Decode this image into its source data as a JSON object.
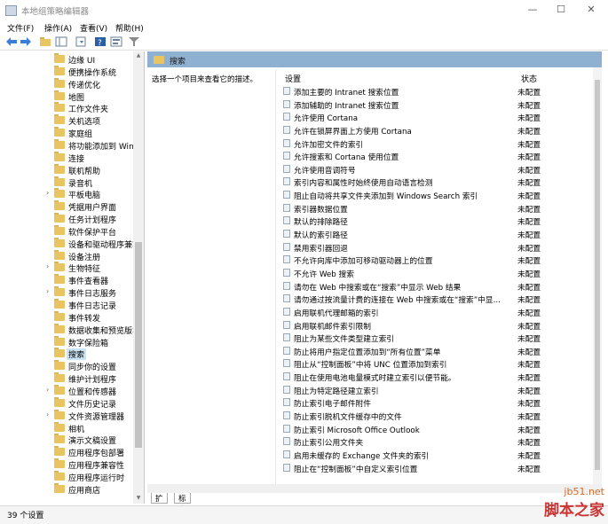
{
  "window": {
    "title": "本地组策略编辑器",
    "controls": {
      "minimize": "—",
      "maximize": "☐",
      "close": "✕"
    }
  },
  "menu": [
    "文件(F)",
    "操作(A)",
    "查看(V)",
    "帮助(H)"
  ],
  "tree": {
    "items": [
      {
        "label": "边缘 UI",
        "expander": ""
      },
      {
        "label": "便携操作系统",
        "expander": ""
      },
      {
        "label": "传递优化",
        "expander": ""
      },
      {
        "label": "地图",
        "expander": ""
      },
      {
        "label": "工作文件夹",
        "expander": ""
      },
      {
        "label": "关机选项",
        "expander": ""
      },
      {
        "label": "家庭组",
        "expander": ""
      },
      {
        "label": "将功能添加到 Wind",
        "expander": ""
      },
      {
        "label": "连接",
        "expander": ""
      },
      {
        "label": "联机帮助",
        "expander": ""
      },
      {
        "label": "录音机",
        "expander": ""
      },
      {
        "label": "平板电脑",
        "expander": "›"
      },
      {
        "label": "凭据用户界面",
        "expander": ""
      },
      {
        "label": "任务计划程序",
        "expander": ""
      },
      {
        "label": "软件保护平台",
        "expander": ""
      },
      {
        "label": "设备和驱动程序兼容",
        "expander": ""
      },
      {
        "label": "设备注册",
        "expander": ""
      },
      {
        "label": "生物特征",
        "expander": "›"
      },
      {
        "label": "事件查看器",
        "expander": ""
      },
      {
        "label": "事件日志服务",
        "expander": "›"
      },
      {
        "label": "事件日志记录",
        "expander": ""
      },
      {
        "label": "事件转发",
        "expander": ""
      },
      {
        "label": "数据收集和预览版本",
        "expander": ""
      },
      {
        "label": "数字保险箱",
        "expander": ""
      },
      {
        "label": "搜索",
        "expander": "",
        "selected": true
      },
      {
        "label": "同步你的设置",
        "expander": ""
      },
      {
        "label": "维护计划程序",
        "expander": ""
      },
      {
        "label": "位置和传感器",
        "expander": "›"
      },
      {
        "label": "文件历史记录",
        "expander": ""
      },
      {
        "label": "文件资源管理器",
        "expander": "›"
      },
      {
        "label": "相机",
        "expander": ""
      },
      {
        "label": "演示文稿设置",
        "expander": ""
      },
      {
        "label": "应用程序包部署",
        "expander": ""
      },
      {
        "label": "应用程序兼容性",
        "expander": ""
      },
      {
        "label": "应用程序运行时",
        "expander": ""
      },
      {
        "label": "应用商店",
        "expander": ""
      }
    ]
  },
  "panel": {
    "header": "搜索",
    "description": "选择一个项目来查看它的描述。",
    "columns": {
      "setting": "设置",
      "state": "状态"
    },
    "rows": [
      {
        "name": "添加主要的 Intranet 搜索位置",
        "state": "未配置"
      },
      {
        "name": "添加辅助的 Intranet 搜索位置",
        "state": "未配置"
      },
      {
        "name": "允许使用 Cortana",
        "state": "未配置"
      },
      {
        "name": "允许在锁屏界面上方使用 Cortana",
        "state": "未配置"
      },
      {
        "name": "允许加密文件的索引",
        "state": "未配置"
      },
      {
        "name": "允许搜索和 Cortana 使用位置",
        "state": "未配置"
      },
      {
        "name": "允许使用音调符号",
        "state": "未配置"
      },
      {
        "name": "索引内容和属性时始终使用自动语言检测",
        "state": "未配置"
      },
      {
        "name": "阻止自动将共享文件夹添加到 Windows Search 索引",
        "state": "未配置"
      },
      {
        "name": "索引器数据位置",
        "state": "未配置"
      },
      {
        "name": "默认的排除路径",
        "state": "未配置"
      },
      {
        "name": "默认的索引路径",
        "state": "未配置"
      },
      {
        "name": "禁用索引器回退",
        "state": "未配置"
      },
      {
        "name": "不允许向库中添加可移动驱动器上的位置",
        "state": "未配置"
      },
      {
        "name": "不允许 Web 搜索",
        "state": "未配置"
      },
      {
        "name": "请勿在 Web 中搜索或在“搜索”中显示 Web 结果",
        "state": "未配置"
      },
      {
        "name": "请勿通过按流量计费的连接在 Web 中搜索或在“搜索”中显...",
        "state": "未配置"
      },
      {
        "name": "启用联机代理邮箱的索引",
        "state": "未配置"
      },
      {
        "name": "启用联机邮件索引限制",
        "state": "未配置"
      },
      {
        "name": "阻止为某些文件类型建立索引",
        "state": "未配置"
      },
      {
        "name": "防止将用户指定位置添加到“所有位置”菜单",
        "state": "未配置"
      },
      {
        "name": "阻止从“控制面板”中将 UNC 位置添加到索引",
        "state": "未配置"
      },
      {
        "name": "阻止在使用电池电量模式时建立索引以便节能。",
        "state": "未配置"
      },
      {
        "name": "阻止为特定路径建立索引",
        "state": "未配置"
      },
      {
        "name": "防止索引电子邮件附件",
        "state": "未配置"
      },
      {
        "name": "防止索引脱机文件缓存中的文件",
        "state": "未配置"
      },
      {
        "name": "防止索引 Microsoft Office Outlook",
        "state": "未配置"
      },
      {
        "name": "防止索引公用文件夹",
        "state": "未配置"
      },
      {
        "name": "启用未缓存的 Exchange 文件夹的索引",
        "state": "未配置"
      },
      {
        "name": "阻止在“控制面板”中自定义索引位置",
        "state": "未配置"
      }
    ]
  },
  "tabs": [
    "扩展",
    "标准"
  ],
  "status": "39 个设置",
  "watermark": {
    "line1": "jb51.net",
    "line2": "脚本之家"
  }
}
